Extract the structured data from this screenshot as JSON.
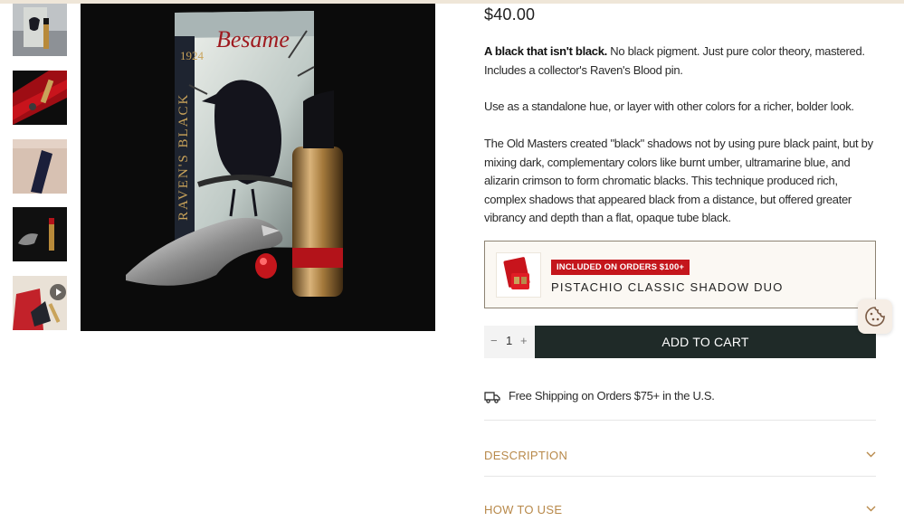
{
  "product": {
    "price": "$40.00",
    "desc_lead": "A black that isn't black.",
    "desc_rest": " No black pigment. Just pure color theory, mastered. Includes a collector's Raven's Blood pin.",
    "desc_2": "Use as a standalone hue, or layer with other colors for a richer, bolder look.",
    "desc_3": "The Old Masters created \"black\" shadows not by using pure black paint, but by mixing dark, complementary colors like burnt umber, ultramarine blue, and alizarin crimson to form chromatic blacks. This technique produced rich, complex shadows that appeared black from a distance, but offered greater vibrancy and depth than a flat, opaque tube black."
  },
  "gallery": {
    "thumbnails": [
      "raven-box-thumb",
      "red-lipstick-thumb",
      "arm-swatch-thumb",
      "raven-pin-thumb",
      "video-thumb"
    ],
    "main_image_box_text": "RAVEN'S BLACK",
    "main_image_year": "1924",
    "main_image_brand": "Besame"
  },
  "promo": {
    "badge": "INCLUDED ON ORDERS $100+",
    "name": "PISTACHIO CLASSIC SHADOW DUO"
  },
  "cart": {
    "minus": "−",
    "quantity": "1",
    "plus": "+",
    "add_label": "ADD TO CART"
  },
  "shipping": {
    "text": "Free Shipping on Orders $75+ in the U.S."
  },
  "accordion": [
    {
      "label": "DESCRIPTION"
    },
    {
      "label": "HOW TO USE"
    }
  ],
  "colors": {
    "accent_gold": "#b8894a",
    "button_dark": "#1f2a28",
    "badge_red": "#c4161c"
  }
}
